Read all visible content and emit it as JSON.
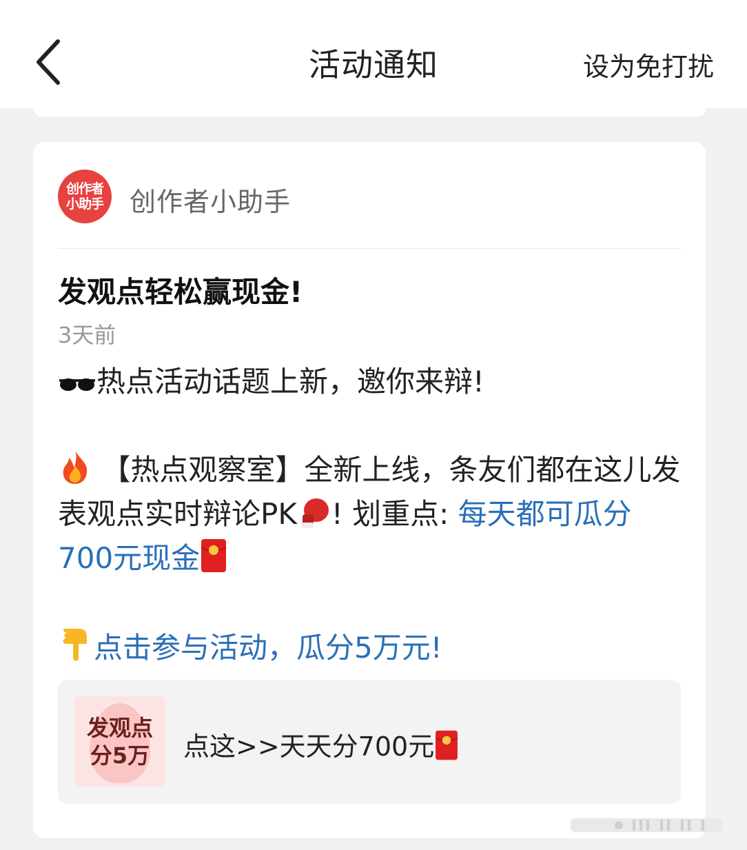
{
  "header": {
    "back_icon": "chevron-left-icon",
    "title": "活动通知",
    "dnd_label": "设为免打扰"
  },
  "message": {
    "avatar_text_line1": "创作者",
    "avatar_text_line2": "小助手",
    "sender_name": "创作者小助手",
    "title": "发观点轻松赢现金!",
    "time": "3天前",
    "line1_text": "热点活动话题上新，邀你来辩!",
    "para2_text": "【热点观察室】全新上线，条友们都在这儿发表观点实时辩论PK",
    "para2_mid": "! 划重点: ",
    "para2_link": "每天都可瓜分700元现金",
    "cta_link": "点击参与活动，瓜分5万元!",
    "emojis": [
      "sunglasses-emoji",
      "fire-emoji",
      "boxing-glove-emoji",
      "red-envelope-emoji",
      "pointing-down-emoji"
    ]
  },
  "attachment": {
    "thumb_line1": "发观点",
    "thumb_line2": "分5万",
    "label": "点这>>天天分700元"
  },
  "colors": {
    "link": "#2a6fb8",
    "avatar_bg": "#e6423f",
    "background": "#f0f1f3"
  }
}
